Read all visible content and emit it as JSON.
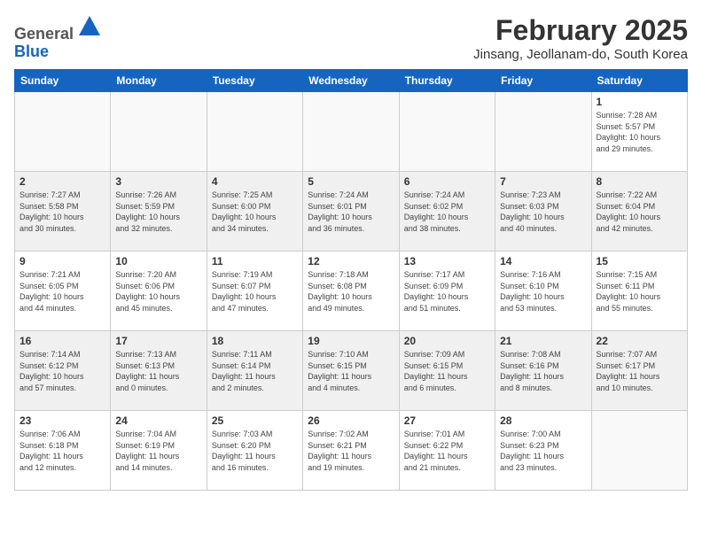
{
  "logo": {
    "general": "General",
    "blue": "Blue"
  },
  "title": "February 2025",
  "location": "Jinsang, Jeollanam-do, South Korea",
  "weekdays": [
    "Sunday",
    "Monday",
    "Tuesday",
    "Wednesday",
    "Thursday",
    "Friday",
    "Saturday"
  ],
  "weeks": [
    [
      {
        "day": "",
        "info": ""
      },
      {
        "day": "",
        "info": ""
      },
      {
        "day": "",
        "info": ""
      },
      {
        "day": "",
        "info": ""
      },
      {
        "day": "",
        "info": ""
      },
      {
        "day": "",
        "info": ""
      },
      {
        "day": "1",
        "info": "Sunrise: 7:28 AM\nSunset: 5:57 PM\nDaylight: 10 hours\nand 29 minutes."
      }
    ],
    [
      {
        "day": "2",
        "info": "Sunrise: 7:27 AM\nSunset: 5:58 PM\nDaylight: 10 hours\nand 30 minutes."
      },
      {
        "day": "3",
        "info": "Sunrise: 7:26 AM\nSunset: 5:59 PM\nDaylight: 10 hours\nand 32 minutes."
      },
      {
        "day": "4",
        "info": "Sunrise: 7:25 AM\nSunset: 6:00 PM\nDaylight: 10 hours\nand 34 minutes."
      },
      {
        "day": "5",
        "info": "Sunrise: 7:24 AM\nSunset: 6:01 PM\nDaylight: 10 hours\nand 36 minutes."
      },
      {
        "day": "6",
        "info": "Sunrise: 7:24 AM\nSunset: 6:02 PM\nDaylight: 10 hours\nand 38 minutes."
      },
      {
        "day": "7",
        "info": "Sunrise: 7:23 AM\nSunset: 6:03 PM\nDaylight: 10 hours\nand 40 minutes."
      },
      {
        "day": "8",
        "info": "Sunrise: 7:22 AM\nSunset: 6:04 PM\nDaylight: 10 hours\nand 42 minutes."
      }
    ],
    [
      {
        "day": "9",
        "info": "Sunrise: 7:21 AM\nSunset: 6:05 PM\nDaylight: 10 hours\nand 44 minutes."
      },
      {
        "day": "10",
        "info": "Sunrise: 7:20 AM\nSunset: 6:06 PM\nDaylight: 10 hours\nand 45 minutes."
      },
      {
        "day": "11",
        "info": "Sunrise: 7:19 AM\nSunset: 6:07 PM\nDaylight: 10 hours\nand 47 minutes."
      },
      {
        "day": "12",
        "info": "Sunrise: 7:18 AM\nSunset: 6:08 PM\nDaylight: 10 hours\nand 49 minutes."
      },
      {
        "day": "13",
        "info": "Sunrise: 7:17 AM\nSunset: 6:09 PM\nDaylight: 10 hours\nand 51 minutes."
      },
      {
        "day": "14",
        "info": "Sunrise: 7:16 AM\nSunset: 6:10 PM\nDaylight: 10 hours\nand 53 minutes."
      },
      {
        "day": "15",
        "info": "Sunrise: 7:15 AM\nSunset: 6:11 PM\nDaylight: 10 hours\nand 55 minutes."
      }
    ],
    [
      {
        "day": "16",
        "info": "Sunrise: 7:14 AM\nSunset: 6:12 PM\nDaylight: 10 hours\nand 57 minutes."
      },
      {
        "day": "17",
        "info": "Sunrise: 7:13 AM\nSunset: 6:13 PM\nDaylight: 11 hours\nand 0 minutes."
      },
      {
        "day": "18",
        "info": "Sunrise: 7:11 AM\nSunset: 6:14 PM\nDaylight: 11 hours\nand 2 minutes."
      },
      {
        "day": "19",
        "info": "Sunrise: 7:10 AM\nSunset: 6:15 PM\nDaylight: 11 hours\nand 4 minutes."
      },
      {
        "day": "20",
        "info": "Sunrise: 7:09 AM\nSunset: 6:15 PM\nDaylight: 11 hours\nand 6 minutes."
      },
      {
        "day": "21",
        "info": "Sunrise: 7:08 AM\nSunset: 6:16 PM\nDaylight: 11 hours\nand 8 minutes."
      },
      {
        "day": "22",
        "info": "Sunrise: 7:07 AM\nSunset: 6:17 PM\nDaylight: 11 hours\nand 10 minutes."
      }
    ],
    [
      {
        "day": "23",
        "info": "Sunrise: 7:06 AM\nSunset: 6:18 PM\nDaylight: 11 hours\nand 12 minutes."
      },
      {
        "day": "24",
        "info": "Sunrise: 7:04 AM\nSunset: 6:19 PM\nDaylight: 11 hours\nand 14 minutes."
      },
      {
        "day": "25",
        "info": "Sunrise: 7:03 AM\nSunset: 6:20 PM\nDaylight: 11 hours\nand 16 minutes."
      },
      {
        "day": "26",
        "info": "Sunrise: 7:02 AM\nSunset: 6:21 PM\nDaylight: 11 hours\nand 19 minutes."
      },
      {
        "day": "27",
        "info": "Sunrise: 7:01 AM\nSunset: 6:22 PM\nDaylight: 11 hours\nand 21 minutes."
      },
      {
        "day": "28",
        "info": "Sunrise: 7:00 AM\nSunset: 6:23 PM\nDaylight: 11 hours\nand 23 minutes."
      },
      {
        "day": "",
        "info": ""
      }
    ]
  ]
}
